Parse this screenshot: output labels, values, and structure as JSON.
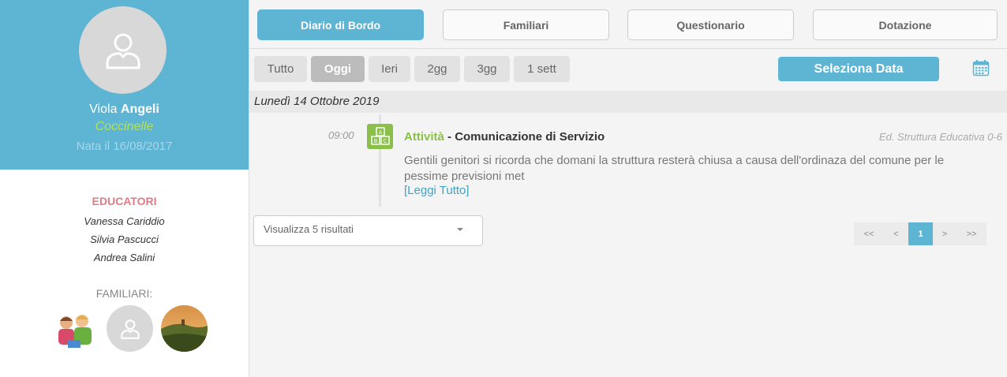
{
  "profile": {
    "first_name": "Viola",
    "last_name": "Angeli",
    "group": "Coccinelle",
    "birth": "Nata il 16/08/2017"
  },
  "educators": {
    "title": "EDUCATORI",
    "names": [
      "Vanessa Cariddio",
      "Silvia Pascucci",
      "Andrea Salini"
    ]
  },
  "family": {
    "title": "FAMILIARI:"
  },
  "tabs": [
    {
      "label": "Diario di Bordo",
      "active": true
    },
    {
      "label": "Familiari",
      "active": false
    },
    {
      "label": "Questionario",
      "active": false
    },
    {
      "label": "Dotazione",
      "active": false
    }
  ],
  "filters": [
    {
      "label": "Tutto",
      "active": false
    },
    {
      "label": "Oggi",
      "active": true
    },
    {
      "label": "Ieri",
      "active": false
    },
    {
      "label": "2gg",
      "active": false
    },
    {
      "label": "3gg",
      "active": false
    },
    {
      "label": "1 sett",
      "active": false
    }
  ],
  "select_date_label": "Seleziona Data",
  "date_header": "Lunedì 14 Ottobre 2019",
  "entry": {
    "time": "09:00",
    "category": "Attività",
    "separator": " - ",
    "title": "Comunicazione di Servizio",
    "author": "Ed. Struttura Educativa 0-6",
    "text": "Gentili genitori si ricorda che domani la struttura resterà chiusa a causa dell'ordinaza del comune per le pessime previsioni met",
    "read_more": "[Leggi Tutto]"
  },
  "results_select": "Visualizza 5 risultati",
  "pagination": [
    "<<",
    "<",
    "1",
    ">",
    ">>"
  ],
  "colors": {
    "accent": "#5db4d3",
    "green": "#8ac04a",
    "educators_title": "#e07b86"
  }
}
